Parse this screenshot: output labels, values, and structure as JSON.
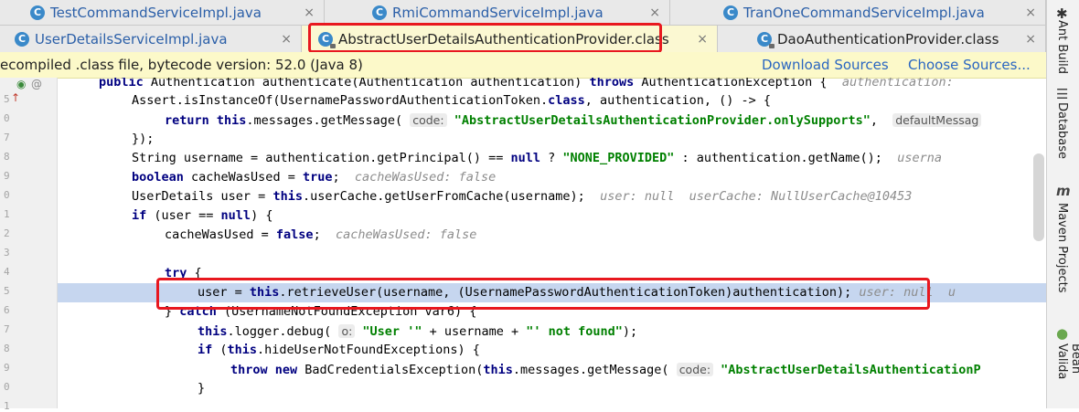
{
  "tabs_row1": [
    {
      "label": "TestCommandServiceImpl.java",
      "icon": "class-c-icon"
    },
    {
      "label": "RmiCommandServiceImpl.java",
      "icon": "class-c-icon"
    },
    {
      "label": "TranOneCommandServiceImpl.java",
      "icon": "class-c-icon"
    }
  ],
  "tabs_row2": [
    {
      "label": "UserDetailsServiceImpl.java",
      "icon": "class-c-icon"
    },
    {
      "label": "AbstractUserDetailsAuthenticationProvider.class",
      "icon": "class-c-locked-icon",
      "active": true
    },
    {
      "label": "DaoAuthenticationProvider.class",
      "icon": "class-c-locked-icon"
    }
  ],
  "close_glyph": "×",
  "banner": {
    "message": "ecompiled .class file, bytecode version: 52.0 (Java 8)",
    "download_sources": "Download Sources",
    "choose_sources": "Choose Sources..."
  },
  "gutter": {
    "numbers": [
      "",
      "5",
      "0",
      "7",
      "8",
      "9",
      "0",
      "1",
      "2",
      "3",
      "4",
      "5",
      "6",
      "7",
      "8",
      "9",
      "0",
      "1"
    ]
  },
  "code": {
    "l0": {
      "p1": "public ",
      "p2": "Authentication authenticate(Authentication authentication) ",
      "p3": "throws ",
      "p4": "AuthenticationException {  ",
      "hint": "authentication:"
    },
    "l1": {
      "p1": "Assert.isInstanceOf(UsernamePasswordAuthenticationToken.",
      "p2": "class",
      "p3": ", authentication, () -> {"
    },
    "l2": {
      "p1": "return this",
      "p2": ".messages.getMessage( ",
      "pill": "code:",
      "str": " \"AbstractUserDetailsAuthenticationProvider.onlySupports\"",
      "p3": ",  ",
      "pill2": "defaultMessag"
    },
    "l3": {
      "p1": "});"
    },
    "l4": {
      "p1": "String username = authentication.getPrincipal() == ",
      "kw": "null",
      "p2": " ? ",
      "str": "\"NONE_PROVIDED\"",
      "p3": " : authentication.getName();  ",
      "hint": "userna"
    },
    "l5": {
      "kw": "boolean",
      "p1": " cacheWasUsed = ",
      "kw2": "true",
      "p2": ";  ",
      "hint": "cacheWasUsed: false"
    },
    "l6": {
      "p1": "UserDetails user = ",
      "kw": "this",
      "p2": ".userCache.getUserFromCache(username);  ",
      "hint": "user: null  userCache: NullUserCache@10453"
    },
    "l7": {
      "kw": "if",
      "p1": " (user == ",
      "kw2": "null",
      "p2": ") {"
    },
    "l8": {
      "p1": "cacheWasUsed = ",
      "kw": "false",
      "p2": ";  ",
      "hint": "cacheWasUsed: false"
    },
    "l9": {
      "p1": ""
    },
    "l10": {
      "kw": "try",
      "p1": " {"
    },
    "l11": {
      "p1": "user = ",
      "kw": "this",
      "p2": ".retrieveUser(username, (UsernamePasswordAuthenticationToken)authentication);",
      "hint": " user: null  u"
    },
    "l12": {
      "p1": "} ",
      "kw": "catch",
      "p2": " (UsernameNotFoundException var6) {"
    },
    "l13": {
      "kw": "this",
      "p1": ".logger.debug( ",
      "pill": "o:",
      "str": " \"User '\"",
      "p2": " + username + ",
      "str2": "\"' not found\"",
      "p3": ");"
    },
    "l14": {
      "kw": "if",
      "p1": " (",
      "kw2": "this",
      "p2": ".hideUserNotFoundExceptions) {"
    },
    "l15": {
      "kw": "throw new",
      "p1": " BadCredentialsException(",
      "kw2": "this",
      "p2": ".messages.getMessage( ",
      "pill": "code:",
      "str": " \"AbstractUserDetailsAuthenticationP"
    },
    "l16": {
      "p1": "}"
    }
  },
  "right_tools": {
    "ant": "Ant Build",
    "database": "Database",
    "maven_glyph": "m",
    "maven": "Maven Projects",
    "bean": "Bean Valida"
  },
  "colors": {
    "highlight_red": "#e8181f",
    "keyword": "#000080",
    "string": "#008000",
    "current_line": "#c6d6ef"
  }
}
